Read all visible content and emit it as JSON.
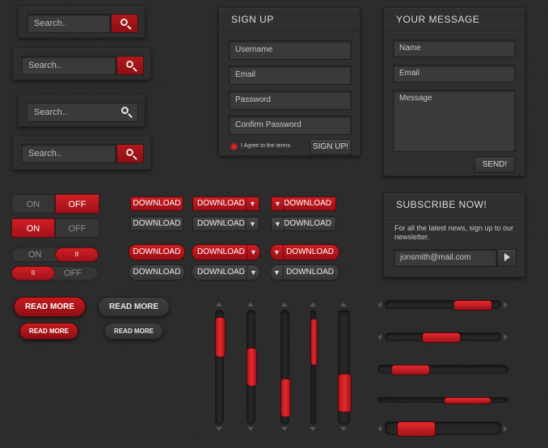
{
  "search": {
    "placeholder": "Search.."
  },
  "signup": {
    "title": "SIGN UP",
    "fields": [
      "Username",
      "Email",
      "Password",
      "Confirm Password"
    ],
    "agree_label": "I Agree to the terms",
    "submit_label": "SIGN UP!"
  },
  "message": {
    "title": "YOUR MESSAGE",
    "name_placeholder": "Name",
    "email_placeholder": "Email",
    "message_placeholder": "Message",
    "send_label": "SEND!"
  },
  "subscribe": {
    "title": "SUBSCRIBE NOW!",
    "text": "For all the latest news, sign up to our newsletter.",
    "email_value": "jonsmith@mail.com"
  },
  "toggles": {
    "on": "ON",
    "off": "OFF",
    "knob": "II"
  },
  "download": {
    "label": "DOWNLOAD",
    "icon_glyph": "▼"
  },
  "readmore": {
    "label": "READ MORE"
  },
  "colors": {
    "accent": "#c0181d",
    "background": "#2b2b2b"
  }
}
